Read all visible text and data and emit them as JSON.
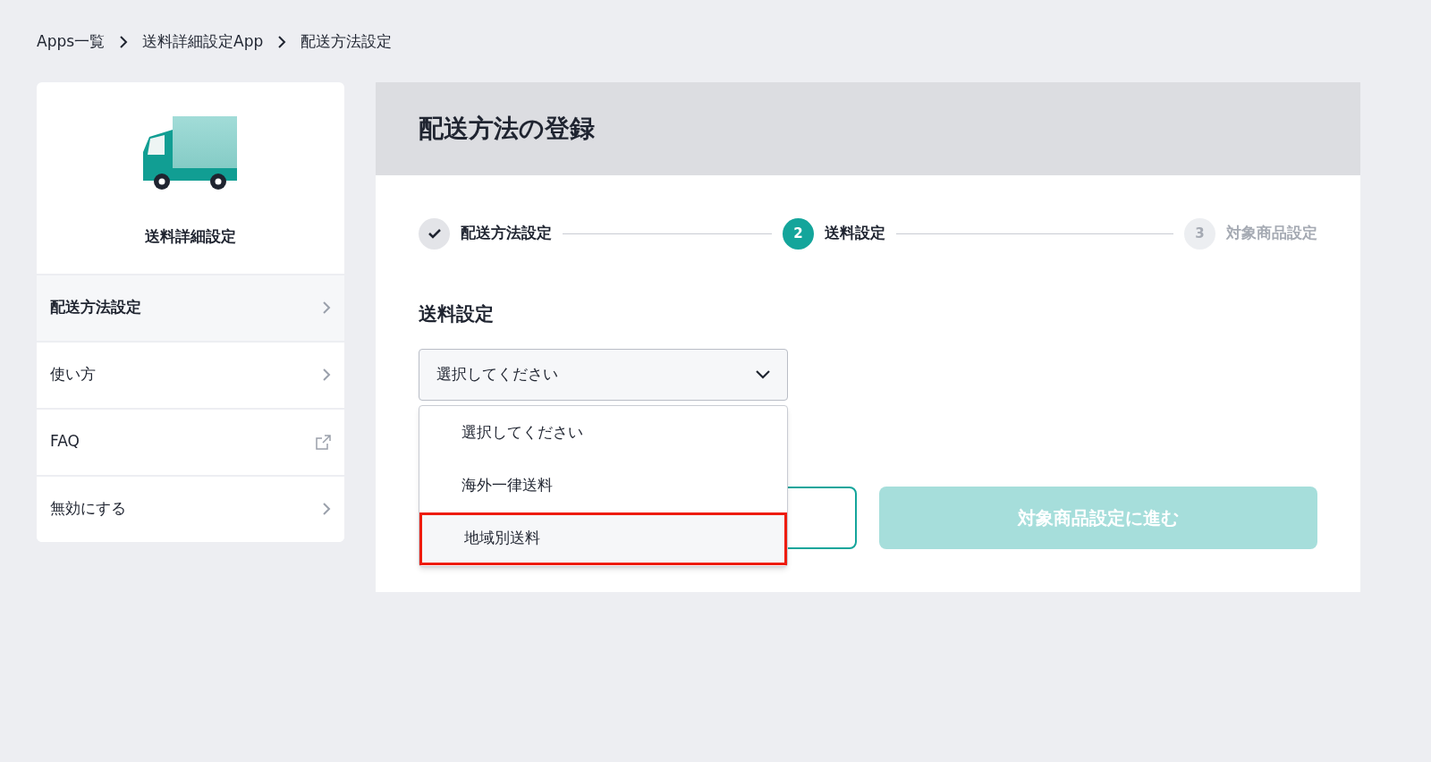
{
  "breadcrumb": [
    {
      "label": "Apps一覧"
    },
    {
      "label": "送料詳細設定App"
    },
    {
      "label": "配送方法設定"
    }
  ],
  "sidebar": {
    "title": "送料詳細設定",
    "items": [
      {
        "label": "配送方法設定",
        "kind": "link",
        "selected": true
      },
      {
        "label": "使い方",
        "kind": "link",
        "selected": false
      },
      {
        "label": "FAQ",
        "kind": "external",
        "selected": false
      },
      {
        "label": "無効にする",
        "kind": "link",
        "selected": false
      }
    ]
  },
  "main": {
    "title": "配送方法の登録",
    "steps": [
      {
        "label": "配送方法設定",
        "done": true,
        "selected": false
      },
      {
        "number": "2",
        "label": "送料設定",
        "done": false,
        "selected": true
      },
      {
        "number": "3",
        "label": "対象商品設定",
        "done": false,
        "selected": false
      }
    ],
    "section_title": "送料設定",
    "select": {
      "value": "選択してください",
      "expanded": true,
      "options": [
        {
          "label": "選択してください",
          "highlighted": false
        },
        {
          "label": "海外一律送料",
          "highlighted": false
        },
        {
          "label": "地域別送料",
          "highlighted": true
        }
      ]
    },
    "next_button": {
      "label": "対象商品設定に進む",
      "disabled": true
    }
  }
}
